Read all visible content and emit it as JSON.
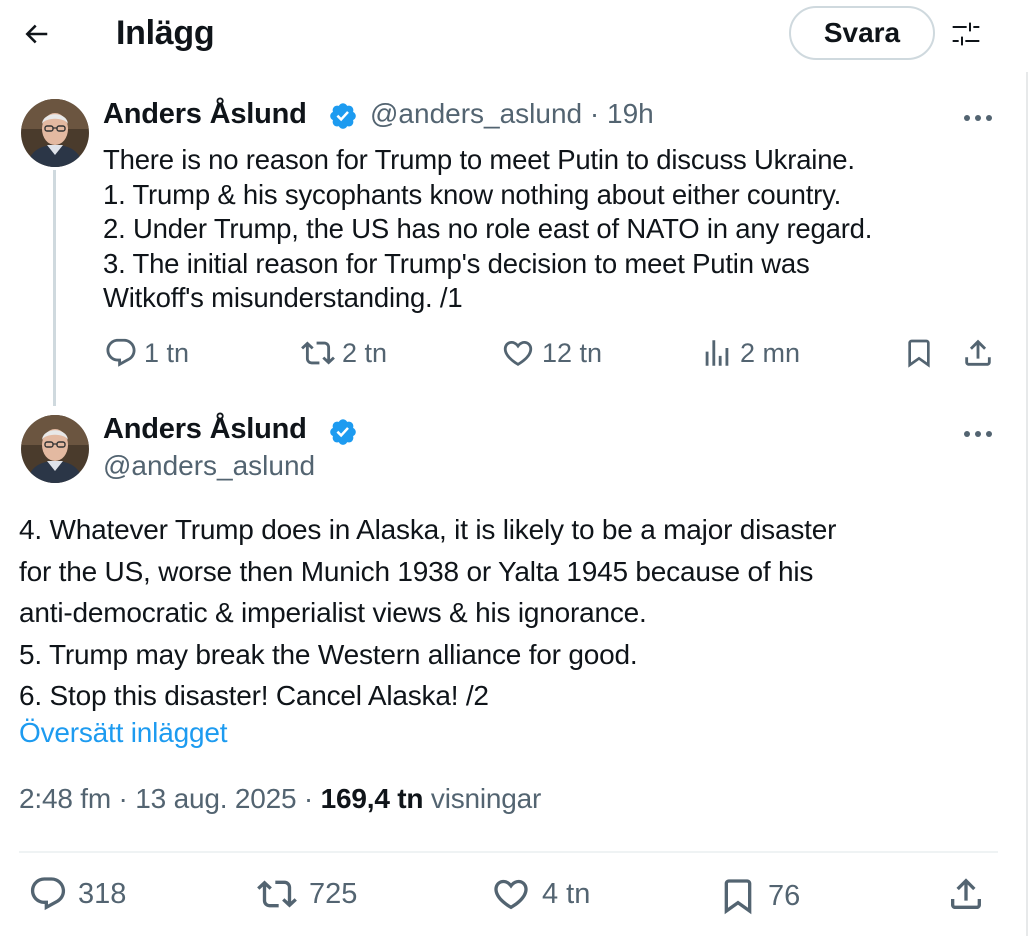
{
  "header": {
    "title": "Inlägg",
    "reply_label": "Svara"
  },
  "tweets": [
    {
      "author_name": "Anders Åslund",
      "handle": "@anders_aslund",
      "time": "19h",
      "lines": [
        "There is no reason for Trump to meet Putin to discuss Ukraine.",
        "1. Trump & his sycophants know nothing about either country.",
        "2. Under Trump, the US has no role east of NATO in any regard.",
        "3. The initial reason for Trump's decision to meet Putin was",
        "Witkoff's misunderstanding. /1"
      ],
      "stats": {
        "replies": "1 tn",
        "reposts": "2 tn",
        "likes": "12 tn",
        "views": "2 mn"
      }
    },
    {
      "author_name": "Anders Åslund",
      "handle": "@anders_aslund",
      "lines": [
        "4. Whatever Trump does in Alaska, it is likely to be a major disaster",
        "for the US, worse then Munich 1938 or Yalta 1945 because of his",
        "anti-democratic & imperialist views & his ignorance.",
        "5. Trump may break the Western alliance for good.",
        "6. Stop this disaster! Cancel Alaska! /2"
      ],
      "translate_label": "Översätt inlägget",
      "timestamp": "2:48 fm · 13 aug. 2025 · ",
      "views_count": "169,4 tn",
      "views_label": "visningar",
      "stats": {
        "replies": "318",
        "reposts": "725",
        "likes": "4 tn",
        "bookmarks": "76"
      }
    }
  ],
  "colors": {
    "text": "#0f1419",
    "secondary": "#536471",
    "accent": "#1d9bf0",
    "verified": "#1d9bf0"
  },
  "icons": [
    "back-arrow-icon",
    "filter-icon",
    "verified-badge-icon",
    "more-icon",
    "reply-icon",
    "repost-icon",
    "like-icon",
    "views-icon",
    "bookmark-icon",
    "share-icon"
  ]
}
